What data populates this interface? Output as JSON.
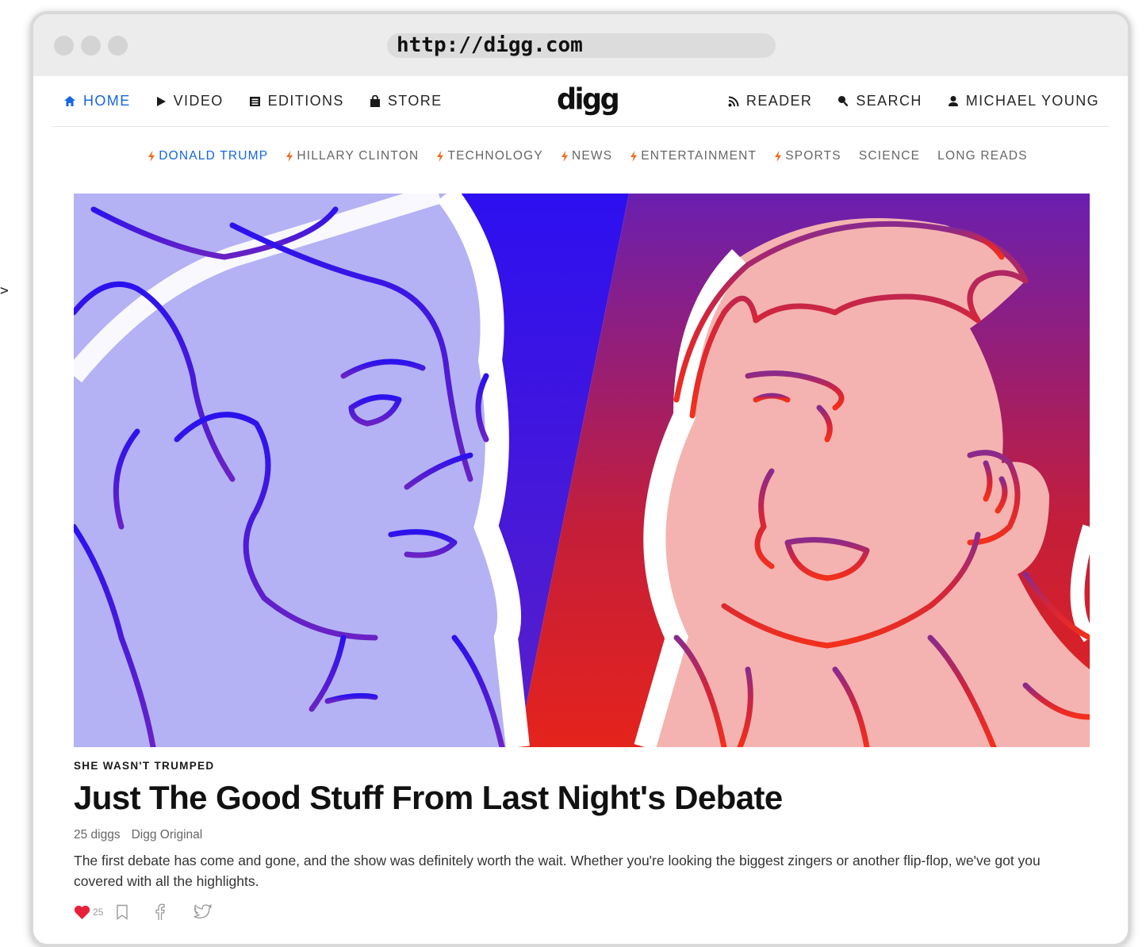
{
  "browser": {
    "url": "http://digg.com"
  },
  "stray_text": ">",
  "nav": {
    "left": [
      {
        "label": "HOME",
        "icon": "home-icon",
        "active": true
      },
      {
        "label": "VIDEO",
        "icon": "play-icon"
      },
      {
        "label": "EDITIONS",
        "icon": "editions-icon"
      },
      {
        "label": "STORE",
        "icon": "bag-icon"
      }
    ],
    "logo": "digg",
    "right": [
      {
        "label": "READER",
        "icon": "rss-icon"
      },
      {
        "label": "SEARCH",
        "icon": "search-icon"
      },
      {
        "label": "MICHAEL YOUNG",
        "icon": "user-icon"
      }
    ]
  },
  "topics": [
    {
      "label": "DONALD TRUMP",
      "trending": true,
      "active": true
    },
    {
      "label": "HILLARY CLINTON",
      "trending": true
    },
    {
      "label": "TECHNOLOGY",
      "trending": true
    },
    {
      "label": "NEWS",
      "trending": true
    },
    {
      "label": "ENTERTAINMENT",
      "trending": true
    },
    {
      "label": "SPORTS",
      "trending": true
    },
    {
      "label": "SCIENCE",
      "trending": false
    },
    {
      "label": "LONG READS",
      "trending": false
    }
  ],
  "article": {
    "kicker": "SHE WASN'T TRUMPED",
    "headline": "Just The Good Stuff From Last Night's Debate",
    "diggs": "25 diggs",
    "source": "Digg Original",
    "summary": "The first debate has come and gone, and the show was definitely worth the wait. Whether you're looking the biggest zingers or another flip-flop, we've got you covered with all the highlights.",
    "like_count": "25"
  },
  "colors": {
    "accent": "#1565e6",
    "bolt": "#f26a1b",
    "heart": "#e8203a",
    "hero_left_bg": "#b4b2f4",
    "hero_right_bg": "#f4b3b1"
  }
}
